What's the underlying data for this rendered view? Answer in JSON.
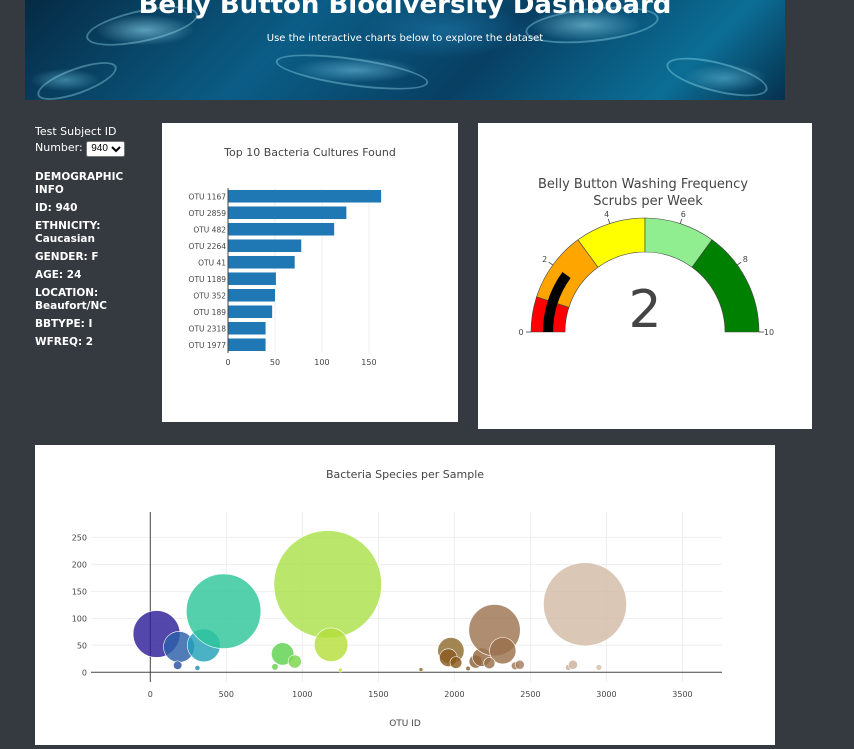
{
  "header": {
    "title": "Belly Button Biodiversity Dashboard",
    "subtitle": "Use the interactive charts below to explore the dataset"
  },
  "selector": {
    "label_line1": "Test Subject ID",
    "label_line2": "Number:",
    "selected": "940"
  },
  "demographics": {
    "heading": "DEMOGRAPHIC INFO",
    "id": "ID: 940",
    "ethnicity": "ETHNICITY: Caucasian",
    "gender": "GENDER: F",
    "age": "AGE: 24",
    "location": "LOCATION: Beaufort/NC",
    "bbtype": "BBTYPE: I",
    "wfreq": "WFREQ: 2"
  },
  "chart_data": [
    {
      "type": "bar",
      "orientation": "horizontal",
      "title": "Top 10 Bacteria Cultures Found",
      "categories": [
        "OTU 1167",
        "OTU 2859",
        "OTU 482",
        "OTU 2264",
        "OTU 41",
        "OTU 1189",
        "OTU 352",
        "OTU 189",
        "OTU 2318",
        "OTU 1977"
      ],
      "values": [
        163,
        126,
        113,
        78,
        71,
        51,
        50,
        47,
        40,
        40
      ],
      "xlim": [
        0,
        165
      ],
      "xticks": [
        0,
        50,
        100,
        150
      ],
      "color": "#1f77b4"
    },
    {
      "type": "gauge",
      "title_line1": "Belly Button Washing Frequency",
      "title_line2": "Scrubs per Week",
      "value": 2,
      "range": [
        0,
        10
      ],
      "ticks": [
        0,
        2,
        4,
        6,
        8,
        10
      ],
      "steps": [
        {
          "range": [
            0,
            1
          ],
          "color": "#ff0000"
        },
        {
          "range": [
            1,
            3
          ],
          "color": "#ffa500"
        },
        {
          "range": [
            3,
            5
          ],
          "color": "#ffff00"
        },
        {
          "range": [
            5,
            7
          ],
          "color": "#90ee90"
        },
        {
          "range": [
            7,
            10
          ],
          "color": "#008000"
        }
      ],
      "bar_color": "#000000"
    },
    {
      "type": "scatter",
      "mode": "bubble",
      "title": "Bacteria Species per Sample",
      "xlabel": "OTU ID",
      "xlim": [
        -390,
        3760
      ],
      "ylim": [
        -18,
        297
      ],
      "xticks": [
        0,
        500,
        1000,
        1500,
        2000,
        2500,
        3000,
        3500
      ],
      "yticks": [
        0,
        50,
        100,
        150,
        200,
        250
      ],
      "grid": true,
      "points": [
        {
          "x": 41,
          "y": 71,
          "color": "#2e1f9a"
        },
        {
          "x": 189,
          "y": 47,
          "color": "#2b5fa8"
        },
        {
          "x": 352,
          "y": 50,
          "color": "#23a1b8"
        },
        {
          "x": 482,
          "y": 113,
          "color": "#2ec79a"
        },
        {
          "x": 870,
          "y": 34,
          "color": "#5ed24e"
        },
        {
          "x": 950,
          "y": 20,
          "color": "#78d64a"
        },
        {
          "x": 1167,
          "y": 163,
          "color": "#a9e04b"
        },
        {
          "x": 1189,
          "y": 51,
          "color": "#b4de3c"
        },
        {
          "x": 1977,
          "y": 40,
          "color": "#8e6b2e"
        },
        {
          "x": 1960,
          "y": 27,
          "color": "#8a5a1e"
        },
        {
          "x": 2140,
          "y": 20,
          "color": "#8b6238"
        },
        {
          "x": 2180,
          "y": 28,
          "color": "#94683f"
        },
        {
          "x": 2264,
          "y": 78,
          "color": "#9c7451"
        },
        {
          "x": 2318,
          "y": 40,
          "color": "#9a704c"
        },
        {
          "x": 2859,
          "y": 126,
          "color": "#d3bba6"
        },
        {
          "x": 180,
          "y": 13,
          "color": "#2a4fa0"
        },
        {
          "x": 310,
          "y": 8,
          "color": "#2690b8"
        },
        {
          "x": 820,
          "y": 10,
          "color": "#6ad04a"
        },
        {
          "x": 1780,
          "y": 5,
          "color": "#8a6a2a"
        },
        {
          "x": 2010,
          "y": 18,
          "color": "#8a5b20"
        },
        {
          "x": 2090,
          "y": 7,
          "color": "#8d6030"
        },
        {
          "x": 2230,
          "y": 17,
          "color": "#97704a"
        },
        {
          "x": 2400,
          "y": 12,
          "color": "#a07a58"
        },
        {
          "x": 2430,
          "y": 14,
          "color": "#a47e5e"
        },
        {
          "x": 2750,
          "y": 9,
          "color": "#c8ad97"
        },
        {
          "x": 2780,
          "y": 14,
          "color": "#ccb29d"
        },
        {
          "x": 2950,
          "y": 9,
          "color": "#d6c0ad"
        },
        {
          "x": 1250,
          "y": 4,
          "color": "#c2e04a"
        }
      ]
    }
  ]
}
